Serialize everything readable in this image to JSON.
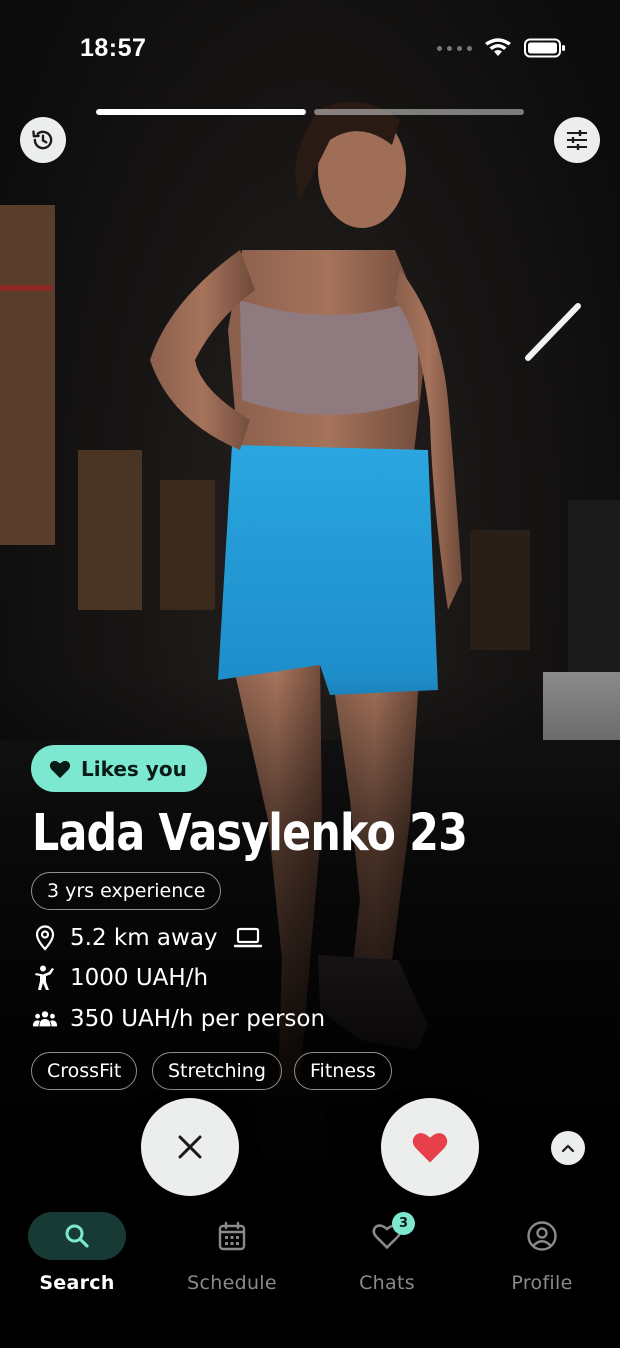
{
  "status_bar": {
    "time": "18:57"
  },
  "story": {
    "segments": 2,
    "active_index": 0,
    "progress": [
      1.0,
      0.0
    ]
  },
  "top_buttons": {
    "left_icon": "history-icon",
    "right_icon": "filter-sliders-icon"
  },
  "profile": {
    "likes_label": "Likes you",
    "name_age": "Lada Vasylenko 23",
    "experience": "3 yrs experience",
    "distance": "5.2 km away",
    "online_icon": "laptop-icon",
    "price_individual": "1000 UAH/h",
    "price_group": "350 UAH/h per person",
    "tags": [
      "CrossFit",
      "Stretching",
      "Fitness"
    ]
  },
  "actions": {
    "dislike_icon": "close-icon",
    "like_icon": "heart-icon",
    "expand_icon": "chevron-up-icon"
  },
  "tabs": [
    {
      "label": "Search",
      "icon": "search-icon",
      "active": true
    },
    {
      "label": "Schedule",
      "icon": "calendar-icon",
      "active": false
    },
    {
      "label": "Chats",
      "icon": "heart-outline-icon",
      "active": false,
      "badge": "3"
    },
    {
      "label": "Profile",
      "icon": "user-circle-icon",
      "active": false
    }
  ],
  "colors": {
    "accent": "#7de8d0",
    "like_red": "#e8404a",
    "button_bg": "#eceeee",
    "active_tab_bg": "#173a34"
  }
}
